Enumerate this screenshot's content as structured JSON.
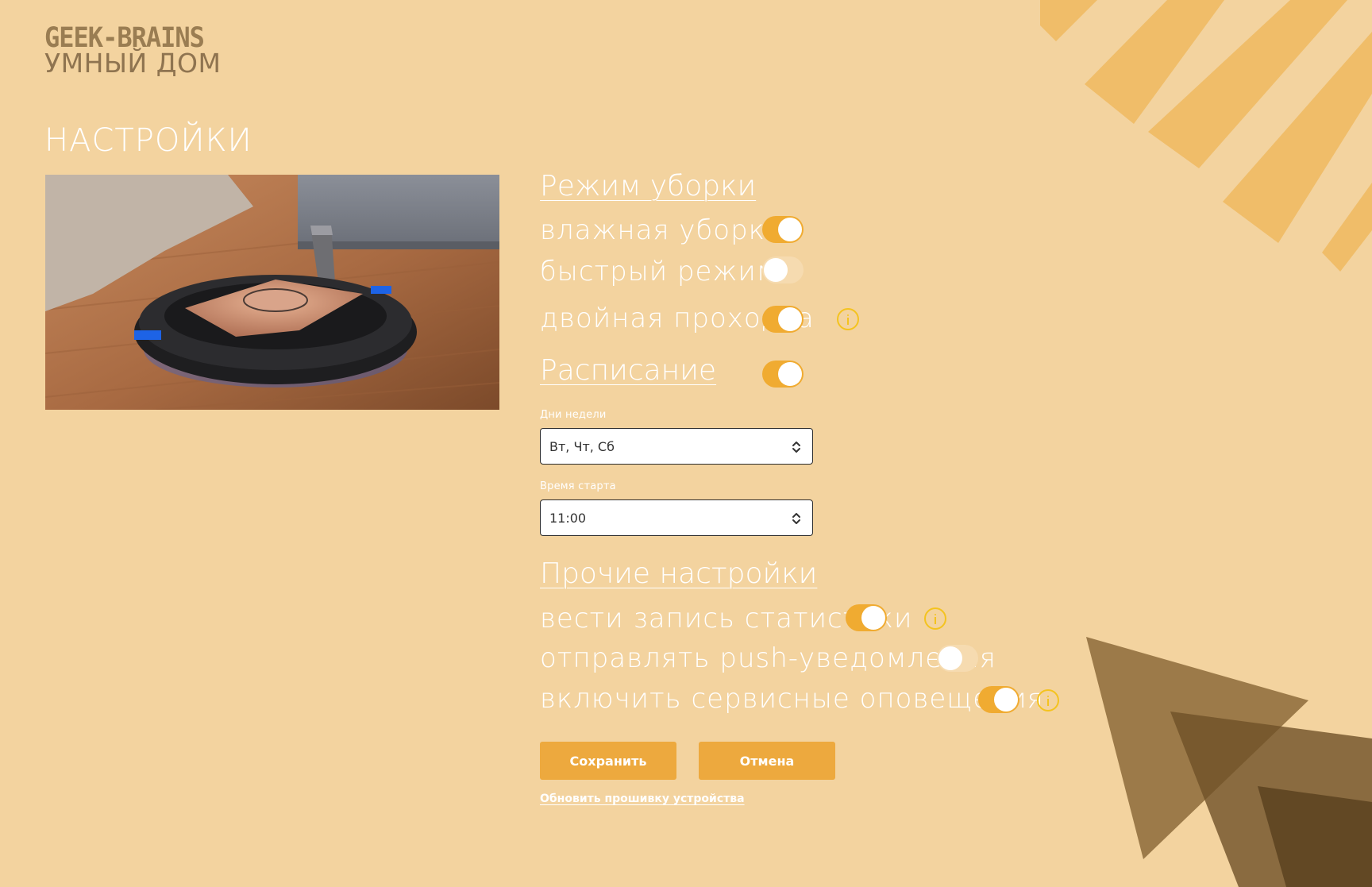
{
  "brand": {
    "name": "GEEK-BRAINS",
    "subtitle": "УМНЫЙ ДОМ"
  },
  "page": {
    "title": "НАСТРОЙКИ"
  },
  "cleaning_mode": {
    "heading": "Режим уборки",
    "options": [
      {
        "label": "влажная уборка",
        "enabled": true,
        "info": false
      },
      {
        "label": "быстрый режим",
        "enabled": false,
        "info": false
      },
      {
        "label": "двойная проходка",
        "enabled": true,
        "info": true
      }
    ]
  },
  "schedule": {
    "heading": "Расписание",
    "enabled": true,
    "days_label": "Дни недели",
    "days_value": "Вт, Чт, Сб",
    "start_label": "Время старта",
    "start_value": "11:00"
  },
  "other": {
    "heading": "Прочие настройки",
    "options": [
      {
        "label": "вести запись статистики",
        "enabled": true,
        "info": true
      },
      {
        "label": "отправлять push-уведомления",
        "enabled": false,
        "info": false
      },
      {
        "label": "включить сервисные оповещения",
        "enabled": true,
        "info": true
      }
    ]
  },
  "actions": {
    "save": "Сохранить",
    "cancel": "Отмена",
    "firmware_link": "Обновить прошивку устройства"
  },
  "colors": {
    "background": "#f3d39f",
    "accent": "#eda93e",
    "toggle_on": "#f0ab31",
    "toggle_off": "#f6dbb0",
    "info": "#f4c31f",
    "stripes": "#f0bd69",
    "triangles": "#8c6a3a"
  }
}
